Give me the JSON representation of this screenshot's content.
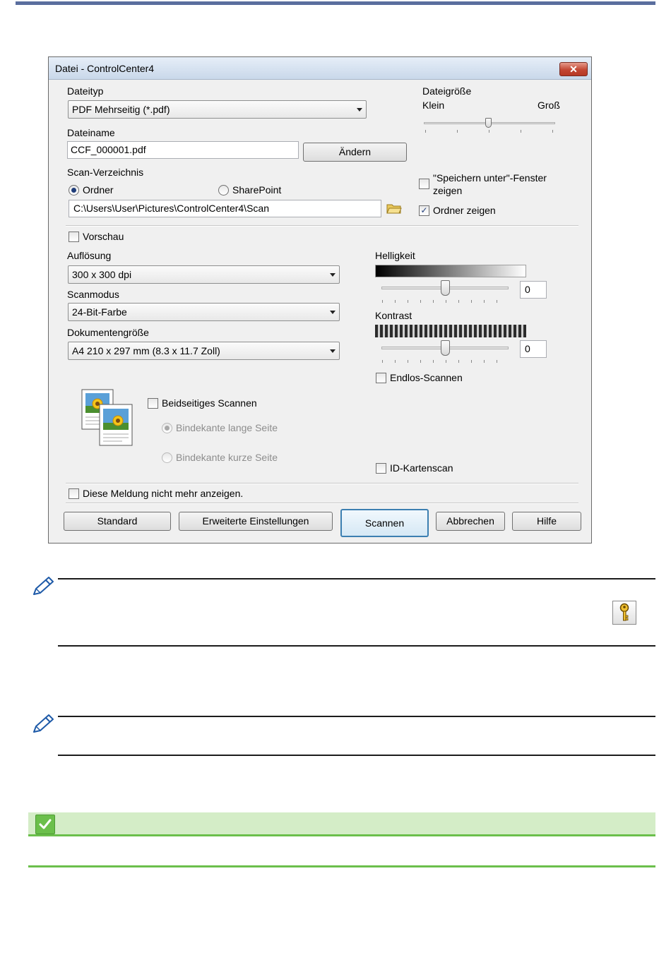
{
  "dialog": {
    "title": "Datei - ControlCenter4",
    "close_label": "✕",
    "file_type": {
      "label": "Dateityp",
      "value": "PDF Mehrseitig (*.pdf)"
    },
    "file_size": {
      "label": "Dateigröße",
      "min_label": "Klein",
      "max_label": "Groß"
    },
    "file_name": {
      "label": "Dateiname",
      "value": "CCF_000001.pdf",
      "change_button": "Ändern"
    },
    "scan_dir": {
      "label": "Scan-Verzeichnis",
      "radio_folder": "Ordner",
      "radio_sharepoint": "SharePoint",
      "path": "C:\\Users\\User\\Pictures\\ControlCenter4\\Scan"
    },
    "save_as_window": {
      "label_line1": "\"Speichern unter\"-Fenster",
      "label_line2": "zeigen",
      "checked": false
    },
    "show_folder": {
      "label": "Ordner zeigen",
      "checked": true
    },
    "preview": {
      "label": "Vorschau",
      "checked": false
    },
    "resolution": {
      "label": "Auflösung",
      "value": "300 x 300 dpi"
    },
    "scan_mode": {
      "label": "Scanmodus",
      "value": "24-Bit-Farbe"
    },
    "doc_size": {
      "label": "Dokumentengröße",
      "value": "A4 210 x 297 mm (8.3 x 11.7 Zoll)"
    },
    "brightness": {
      "label": "Helligkeit",
      "value": "0"
    },
    "contrast": {
      "label": "Kontrast",
      "value": "0"
    },
    "continuous_scan": {
      "label": "Endlos-Scannen",
      "checked": false
    },
    "duplex": {
      "label": "Beidseitiges Scannen",
      "long_edge": "Bindekante lange Seite",
      "short_edge": "Bindekante kurze Seite",
      "checked": false
    },
    "id_card_scan": {
      "label": "ID-Kartenscan",
      "checked": false
    },
    "dont_show": {
      "label": "Diese Meldung nicht mehr anzeigen.",
      "checked": false
    },
    "buttons": {
      "standard": "Standard",
      "advanced": "Erweiterte Einstellungen",
      "scan": "Scannen",
      "cancel": "Abbrechen",
      "help": "Hilfe"
    }
  },
  "colors": {
    "accent_bar": "#5a6e9e",
    "green_bar": "#d4edc7",
    "green_accent": "#6bbf4b"
  }
}
